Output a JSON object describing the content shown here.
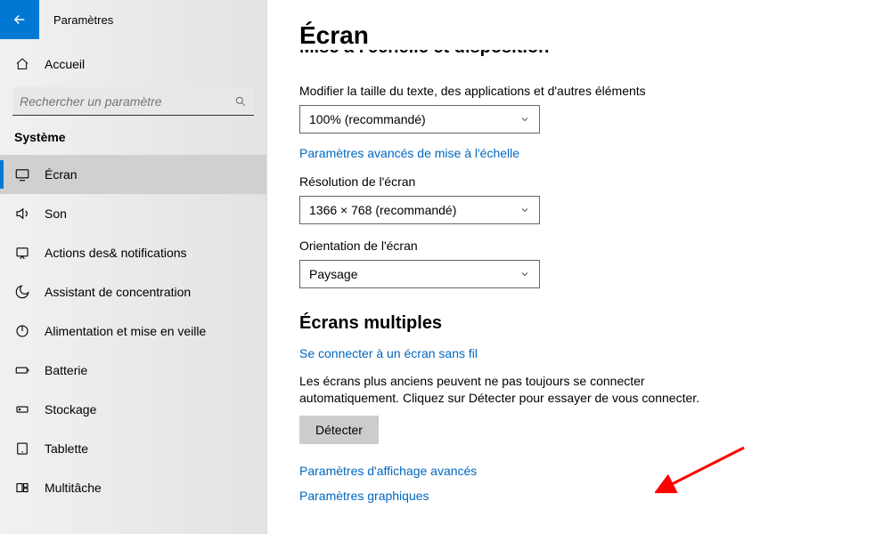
{
  "titlebar": {
    "title": "Paramètres"
  },
  "sidebar": {
    "home": "Accueil",
    "search_placeholder": "Rechercher un paramètre",
    "section": "Système",
    "items": [
      {
        "label": "Écran"
      },
      {
        "label": "Son"
      },
      {
        "label": "Actions des& notifications"
      },
      {
        "label": "Assistant de concentration"
      },
      {
        "label": "Alimentation et mise en veille"
      },
      {
        "label": "Batterie"
      },
      {
        "label": "Stockage"
      },
      {
        "label": "Tablette"
      },
      {
        "label": "Multitâche"
      }
    ]
  },
  "main": {
    "title": "Écran",
    "cut_section": "Mise à l'échelle et disposition",
    "scale_label": "Modifier la taille du texte, des applications et d'autres éléments",
    "scale_value": "100% (recommandé)",
    "scale_link": "Paramètres avancés de mise à l'échelle",
    "resolution_label": "Résolution de l'écran",
    "resolution_value": "1366 × 768 (recommandé)",
    "orientation_label": "Orientation de l'écran",
    "orientation_value": "Paysage",
    "multi_heading": "Écrans multiples",
    "wireless_link": "Se connecter à un écran sans fil",
    "detect_helper": "Les écrans plus anciens peuvent ne pas toujours se connecter automatiquement. Cliquez sur Détecter pour essayer de vous connecter.",
    "detect_button": "Détecter",
    "advanced_link": "Paramètres d'affichage avancés",
    "graphics_link": "Paramètres graphiques"
  }
}
